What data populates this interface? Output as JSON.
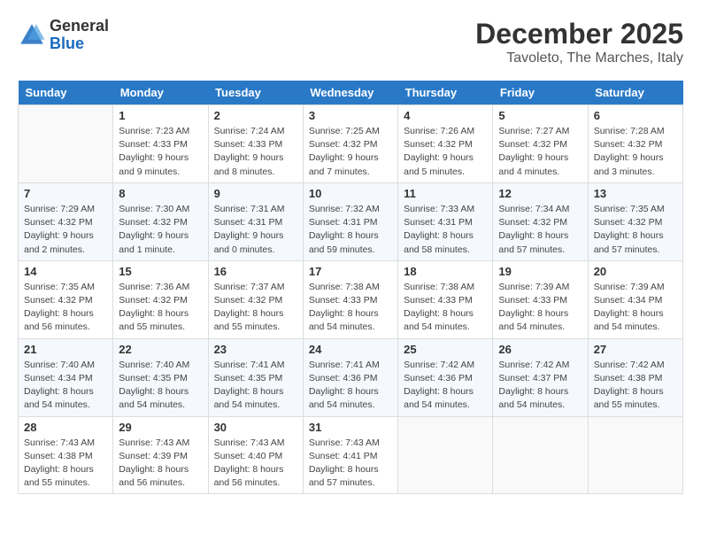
{
  "header": {
    "logo_general": "General",
    "logo_blue": "Blue",
    "month_title": "December 2025",
    "location": "Tavoleto, The Marches, Italy"
  },
  "weekdays": [
    "Sunday",
    "Monday",
    "Tuesday",
    "Wednesday",
    "Thursday",
    "Friday",
    "Saturday"
  ],
  "weeks": [
    [
      {
        "day": "",
        "sunrise": "",
        "sunset": "",
        "daylight": ""
      },
      {
        "day": "1",
        "sunrise": "Sunrise: 7:23 AM",
        "sunset": "Sunset: 4:33 PM",
        "daylight": "Daylight: 9 hours and 9 minutes."
      },
      {
        "day": "2",
        "sunrise": "Sunrise: 7:24 AM",
        "sunset": "Sunset: 4:33 PM",
        "daylight": "Daylight: 9 hours and 8 minutes."
      },
      {
        "day": "3",
        "sunrise": "Sunrise: 7:25 AM",
        "sunset": "Sunset: 4:32 PM",
        "daylight": "Daylight: 9 hours and 7 minutes."
      },
      {
        "day": "4",
        "sunrise": "Sunrise: 7:26 AM",
        "sunset": "Sunset: 4:32 PM",
        "daylight": "Daylight: 9 hours and 5 minutes."
      },
      {
        "day": "5",
        "sunrise": "Sunrise: 7:27 AM",
        "sunset": "Sunset: 4:32 PM",
        "daylight": "Daylight: 9 hours and 4 minutes."
      },
      {
        "day": "6",
        "sunrise": "Sunrise: 7:28 AM",
        "sunset": "Sunset: 4:32 PM",
        "daylight": "Daylight: 9 hours and 3 minutes."
      }
    ],
    [
      {
        "day": "7",
        "sunrise": "Sunrise: 7:29 AM",
        "sunset": "Sunset: 4:32 PM",
        "daylight": "Daylight: 9 hours and 2 minutes."
      },
      {
        "day": "8",
        "sunrise": "Sunrise: 7:30 AM",
        "sunset": "Sunset: 4:32 PM",
        "daylight": "Daylight: 9 hours and 1 minute."
      },
      {
        "day": "9",
        "sunrise": "Sunrise: 7:31 AM",
        "sunset": "Sunset: 4:31 PM",
        "daylight": "Daylight: 9 hours and 0 minutes."
      },
      {
        "day": "10",
        "sunrise": "Sunrise: 7:32 AM",
        "sunset": "Sunset: 4:31 PM",
        "daylight": "Daylight: 8 hours and 59 minutes."
      },
      {
        "day": "11",
        "sunrise": "Sunrise: 7:33 AM",
        "sunset": "Sunset: 4:31 PM",
        "daylight": "Daylight: 8 hours and 58 minutes."
      },
      {
        "day": "12",
        "sunrise": "Sunrise: 7:34 AM",
        "sunset": "Sunset: 4:32 PM",
        "daylight": "Daylight: 8 hours and 57 minutes."
      },
      {
        "day": "13",
        "sunrise": "Sunrise: 7:35 AM",
        "sunset": "Sunset: 4:32 PM",
        "daylight": "Daylight: 8 hours and 57 minutes."
      }
    ],
    [
      {
        "day": "14",
        "sunrise": "Sunrise: 7:35 AM",
        "sunset": "Sunset: 4:32 PM",
        "daylight": "Daylight: 8 hours and 56 minutes."
      },
      {
        "day": "15",
        "sunrise": "Sunrise: 7:36 AM",
        "sunset": "Sunset: 4:32 PM",
        "daylight": "Daylight: 8 hours and 55 minutes."
      },
      {
        "day": "16",
        "sunrise": "Sunrise: 7:37 AM",
        "sunset": "Sunset: 4:32 PM",
        "daylight": "Daylight: 8 hours and 55 minutes."
      },
      {
        "day": "17",
        "sunrise": "Sunrise: 7:38 AM",
        "sunset": "Sunset: 4:33 PM",
        "daylight": "Daylight: 8 hours and 54 minutes."
      },
      {
        "day": "18",
        "sunrise": "Sunrise: 7:38 AM",
        "sunset": "Sunset: 4:33 PM",
        "daylight": "Daylight: 8 hours and 54 minutes."
      },
      {
        "day": "19",
        "sunrise": "Sunrise: 7:39 AM",
        "sunset": "Sunset: 4:33 PM",
        "daylight": "Daylight: 8 hours and 54 minutes."
      },
      {
        "day": "20",
        "sunrise": "Sunrise: 7:39 AM",
        "sunset": "Sunset: 4:34 PM",
        "daylight": "Daylight: 8 hours and 54 minutes."
      }
    ],
    [
      {
        "day": "21",
        "sunrise": "Sunrise: 7:40 AM",
        "sunset": "Sunset: 4:34 PM",
        "daylight": "Daylight: 8 hours and 54 minutes."
      },
      {
        "day": "22",
        "sunrise": "Sunrise: 7:40 AM",
        "sunset": "Sunset: 4:35 PM",
        "daylight": "Daylight: 8 hours and 54 minutes."
      },
      {
        "day": "23",
        "sunrise": "Sunrise: 7:41 AM",
        "sunset": "Sunset: 4:35 PM",
        "daylight": "Daylight: 8 hours and 54 minutes."
      },
      {
        "day": "24",
        "sunrise": "Sunrise: 7:41 AM",
        "sunset": "Sunset: 4:36 PM",
        "daylight": "Daylight: 8 hours and 54 minutes."
      },
      {
        "day": "25",
        "sunrise": "Sunrise: 7:42 AM",
        "sunset": "Sunset: 4:36 PM",
        "daylight": "Daylight: 8 hours and 54 minutes."
      },
      {
        "day": "26",
        "sunrise": "Sunrise: 7:42 AM",
        "sunset": "Sunset: 4:37 PM",
        "daylight": "Daylight: 8 hours and 54 minutes."
      },
      {
        "day": "27",
        "sunrise": "Sunrise: 7:42 AM",
        "sunset": "Sunset: 4:38 PM",
        "daylight": "Daylight: 8 hours and 55 minutes."
      }
    ],
    [
      {
        "day": "28",
        "sunrise": "Sunrise: 7:43 AM",
        "sunset": "Sunset: 4:38 PM",
        "daylight": "Daylight: 8 hours and 55 minutes."
      },
      {
        "day": "29",
        "sunrise": "Sunrise: 7:43 AM",
        "sunset": "Sunset: 4:39 PM",
        "daylight": "Daylight: 8 hours and 56 minutes."
      },
      {
        "day": "30",
        "sunrise": "Sunrise: 7:43 AM",
        "sunset": "Sunset: 4:40 PM",
        "daylight": "Daylight: 8 hours and 56 minutes."
      },
      {
        "day": "31",
        "sunrise": "Sunrise: 7:43 AM",
        "sunset": "Sunset: 4:41 PM",
        "daylight": "Daylight: 8 hours and 57 minutes."
      },
      {
        "day": "",
        "sunrise": "",
        "sunset": "",
        "daylight": ""
      },
      {
        "day": "",
        "sunrise": "",
        "sunset": "",
        "daylight": ""
      },
      {
        "day": "",
        "sunrise": "",
        "sunset": "",
        "daylight": ""
      }
    ]
  ]
}
